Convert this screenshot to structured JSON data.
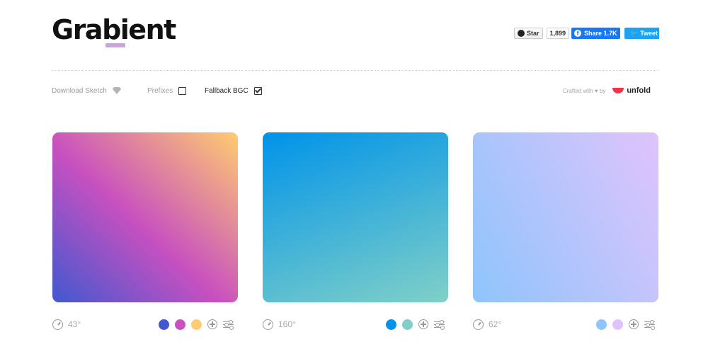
{
  "header": {
    "logo": "Grabient",
    "github": {
      "label": "Star",
      "count": "1,899"
    },
    "facebook": {
      "label": "Share 1.7K"
    },
    "twitter": {
      "label": "Tweet"
    }
  },
  "toolbar": {
    "download_sketch": "Download Sketch",
    "prefixes": {
      "label": "Prefixes",
      "checked": false
    },
    "fallback": {
      "label": "Fallback BGC",
      "checked": true
    },
    "crafted": "Crafted with ♥ by",
    "brand": "unfold"
  },
  "gradients": [
    {
      "angle": "43°",
      "stops": [
        "#4158D0",
        "#C850C0",
        "#FFCC70"
      ]
    },
    {
      "angle": "160°",
      "stops": [
        "#0093E9",
        "#80D0C7"
      ]
    },
    {
      "angle": "62°",
      "stops": [
        "#8EC5FC",
        "#E0C3FC"
      ]
    }
  ],
  "colors": {
    "facebook": "#1877f2",
    "twitter": "#1da1f2",
    "unfold": "#f0324a",
    "logo_underline": "#c8a6dc"
  }
}
